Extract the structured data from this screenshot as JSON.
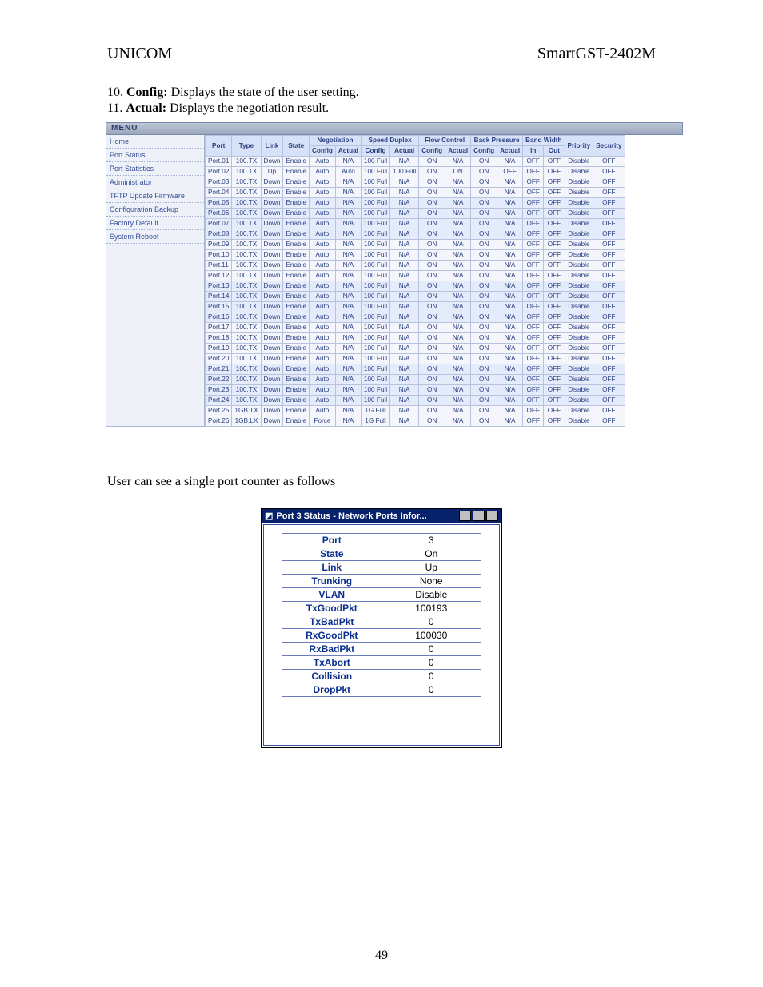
{
  "header": {
    "left": "UNICOM",
    "right": "SmartGST-2402M"
  },
  "definitions": [
    {
      "n": "10.",
      "term": "Config:",
      "desc": "Displays the state of the user setting."
    },
    {
      "n": "11.",
      "term": "Actual:",
      "desc": "Displays the negotiation result."
    }
  ],
  "menu_title": "MENU",
  "menu_items": [
    "Home",
    "Port Status",
    "Port Statistics",
    "Administrator",
    "TFTP Update Firmware",
    "Configuration Backup",
    "Factory Default",
    "System Reboot"
  ],
  "port_headers": {
    "row1": [
      "Port",
      "Type",
      "Link",
      "State",
      "Negotiation",
      "Speed Duplex",
      "Flow Control",
      "Back Pressure",
      "Band Width",
      "Priority",
      "Security"
    ],
    "row2": [
      "Config",
      "Actual",
      "Config",
      "Actual",
      "Config",
      "Actual",
      "Config",
      "Actual",
      "In",
      "Out"
    ]
  },
  "ports": [
    {
      "p": "Port.01",
      "t": "100.TX",
      "l": "Down",
      "s": "Enable",
      "nc": "Auto",
      "na": "N/A",
      "sc": "100 Full",
      "sa": "N/A",
      "fc": "ON",
      "fa": "N/A",
      "bc": "ON",
      "ba": "N/A",
      "wi": "OFF",
      "wo": "OFF",
      "pr": "Disable",
      "se": "OFF"
    },
    {
      "p": "Port.02",
      "t": "100.TX",
      "l": "Up",
      "s": "Enable",
      "nc": "Auto",
      "na": "Auto",
      "sc": "100 Full",
      "sa": "100 Full",
      "fc": "ON",
      "fa": "ON",
      "bc": "ON",
      "ba": "OFF",
      "wi": "OFF",
      "wo": "OFF",
      "pr": "Disable",
      "se": "OFF"
    },
    {
      "p": "Port.03",
      "t": "100.TX",
      "l": "Down",
      "s": "Enable",
      "nc": "Auto",
      "na": "N/A",
      "sc": "100 Full",
      "sa": "N/A",
      "fc": "ON",
      "fa": "N/A",
      "bc": "ON",
      "ba": "N/A",
      "wi": "OFF",
      "wo": "OFF",
      "pr": "Disable",
      "se": "OFF"
    },
    {
      "p": "Port.04",
      "t": "100.TX",
      "l": "Down",
      "s": "Enable",
      "nc": "Auto",
      "na": "N/A",
      "sc": "100 Full",
      "sa": "N/A",
      "fc": "ON",
      "fa": "N/A",
      "bc": "ON",
      "ba": "N/A",
      "wi": "OFF",
      "wo": "OFF",
      "pr": "Disable",
      "se": "OFF"
    },
    {
      "p": "Port.05",
      "t": "100.TX",
      "l": "Down",
      "s": "Enable",
      "nc": "Auto",
      "na": "N/A",
      "sc": "100 Full",
      "sa": "N/A",
      "fc": "ON",
      "fa": "N/A",
      "bc": "ON",
      "ba": "N/A",
      "wi": "OFF",
      "wo": "OFF",
      "pr": "Disable",
      "se": "OFF"
    },
    {
      "p": "Port.06",
      "t": "100.TX",
      "l": "Down",
      "s": "Enable",
      "nc": "Auto",
      "na": "N/A",
      "sc": "100 Full",
      "sa": "N/A",
      "fc": "ON",
      "fa": "N/A",
      "bc": "ON",
      "ba": "N/A",
      "wi": "OFF",
      "wo": "OFF",
      "pr": "Disable",
      "se": "OFF"
    },
    {
      "p": "Port.07",
      "t": "100.TX",
      "l": "Down",
      "s": "Enable",
      "nc": "Auto",
      "na": "N/A",
      "sc": "100 Full",
      "sa": "N/A",
      "fc": "ON",
      "fa": "N/A",
      "bc": "ON",
      "ba": "N/A",
      "wi": "OFF",
      "wo": "OFF",
      "pr": "Disable",
      "se": "OFF"
    },
    {
      "p": "Port.08",
      "t": "100.TX",
      "l": "Down",
      "s": "Enable",
      "nc": "Auto",
      "na": "N/A",
      "sc": "100 Full",
      "sa": "N/A",
      "fc": "ON",
      "fa": "N/A",
      "bc": "ON",
      "ba": "N/A",
      "wi": "OFF",
      "wo": "OFF",
      "pr": "Disable",
      "se": "OFF"
    },
    {
      "p": "Port.09",
      "t": "100.TX",
      "l": "Down",
      "s": "Enable",
      "nc": "Auto",
      "na": "N/A",
      "sc": "100 Full",
      "sa": "N/A",
      "fc": "ON",
      "fa": "N/A",
      "bc": "ON",
      "ba": "N/A",
      "wi": "OFF",
      "wo": "OFF",
      "pr": "Disable",
      "se": "OFF"
    },
    {
      "p": "Port.10",
      "t": "100.TX",
      "l": "Down",
      "s": "Enable",
      "nc": "Auto",
      "na": "N/A",
      "sc": "100 Full",
      "sa": "N/A",
      "fc": "ON",
      "fa": "N/A",
      "bc": "ON",
      "ba": "N/A",
      "wi": "OFF",
      "wo": "OFF",
      "pr": "Disable",
      "se": "OFF"
    },
    {
      "p": "Port.11",
      "t": "100.TX",
      "l": "Down",
      "s": "Enable",
      "nc": "Auto",
      "na": "N/A",
      "sc": "100 Full",
      "sa": "N/A",
      "fc": "ON",
      "fa": "N/A",
      "bc": "ON",
      "ba": "N/A",
      "wi": "OFF",
      "wo": "OFF",
      "pr": "Disable",
      "se": "OFF"
    },
    {
      "p": "Port.12",
      "t": "100.TX",
      "l": "Down",
      "s": "Enable",
      "nc": "Auto",
      "na": "N/A",
      "sc": "100 Full",
      "sa": "N/A",
      "fc": "ON",
      "fa": "N/A",
      "bc": "ON",
      "ba": "N/A",
      "wi": "OFF",
      "wo": "OFF",
      "pr": "Disable",
      "se": "OFF"
    },
    {
      "p": "Port.13",
      "t": "100.TX",
      "l": "Down",
      "s": "Enable",
      "nc": "Auto",
      "na": "N/A",
      "sc": "100 Full",
      "sa": "N/A",
      "fc": "ON",
      "fa": "N/A",
      "bc": "ON",
      "ba": "N/A",
      "wi": "OFF",
      "wo": "OFF",
      "pr": "Disable",
      "se": "OFF"
    },
    {
      "p": "Port.14",
      "t": "100.TX",
      "l": "Down",
      "s": "Enable",
      "nc": "Auto",
      "na": "N/A",
      "sc": "100 Full",
      "sa": "N/A",
      "fc": "ON",
      "fa": "N/A",
      "bc": "ON",
      "ba": "N/A",
      "wi": "OFF",
      "wo": "OFF",
      "pr": "Disable",
      "se": "OFF"
    },
    {
      "p": "Port.15",
      "t": "100.TX",
      "l": "Down",
      "s": "Enable",
      "nc": "Auto",
      "na": "N/A",
      "sc": "100 Full",
      "sa": "N/A",
      "fc": "ON",
      "fa": "N/A",
      "bc": "ON",
      "ba": "N/A",
      "wi": "OFF",
      "wo": "OFF",
      "pr": "Disable",
      "se": "OFF"
    },
    {
      "p": "Port.16",
      "t": "100.TX",
      "l": "Down",
      "s": "Enable",
      "nc": "Auto",
      "na": "N/A",
      "sc": "100 Full",
      "sa": "N/A",
      "fc": "ON",
      "fa": "N/A",
      "bc": "ON",
      "ba": "N/A",
      "wi": "OFF",
      "wo": "OFF",
      "pr": "Disable",
      "se": "OFF"
    },
    {
      "p": "Port.17",
      "t": "100.TX",
      "l": "Down",
      "s": "Enable",
      "nc": "Auto",
      "na": "N/A",
      "sc": "100 Full",
      "sa": "N/A",
      "fc": "ON",
      "fa": "N/A",
      "bc": "ON",
      "ba": "N/A",
      "wi": "OFF",
      "wo": "OFF",
      "pr": "Disable",
      "se": "OFF"
    },
    {
      "p": "Port.18",
      "t": "100.TX",
      "l": "Down",
      "s": "Enable",
      "nc": "Auto",
      "na": "N/A",
      "sc": "100 Full",
      "sa": "N/A",
      "fc": "ON",
      "fa": "N/A",
      "bc": "ON",
      "ba": "N/A",
      "wi": "OFF",
      "wo": "OFF",
      "pr": "Disable",
      "se": "OFF"
    },
    {
      "p": "Port.19",
      "t": "100.TX",
      "l": "Down",
      "s": "Enable",
      "nc": "Auto",
      "na": "N/A",
      "sc": "100 Full",
      "sa": "N/A",
      "fc": "ON",
      "fa": "N/A",
      "bc": "ON",
      "ba": "N/A",
      "wi": "OFF",
      "wo": "OFF",
      "pr": "Disable",
      "se": "OFF"
    },
    {
      "p": "Port.20",
      "t": "100.TX",
      "l": "Down",
      "s": "Enable",
      "nc": "Auto",
      "na": "N/A",
      "sc": "100 Full",
      "sa": "N/A",
      "fc": "ON",
      "fa": "N/A",
      "bc": "ON",
      "ba": "N/A",
      "wi": "OFF",
      "wo": "OFF",
      "pr": "Disable",
      "se": "OFF"
    },
    {
      "p": "Port.21",
      "t": "100.TX",
      "l": "Down",
      "s": "Enable",
      "nc": "Auto",
      "na": "N/A",
      "sc": "100 Full",
      "sa": "N/A",
      "fc": "ON",
      "fa": "N/A",
      "bc": "ON",
      "ba": "N/A",
      "wi": "OFF",
      "wo": "OFF",
      "pr": "Disable",
      "se": "OFF"
    },
    {
      "p": "Port.22",
      "t": "100.TX",
      "l": "Down",
      "s": "Enable",
      "nc": "Auto",
      "na": "N/A",
      "sc": "100 Full",
      "sa": "N/A",
      "fc": "ON",
      "fa": "N/A",
      "bc": "ON",
      "ba": "N/A",
      "wi": "OFF",
      "wo": "OFF",
      "pr": "Disable",
      "se": "OFF"
    },
    {
      "p": "Port.23",
      "t": "100.TX",
      "l": "Down",
      "s": "Enable",
      "nc": "Auto",
      "na": "N/A",
      "sc": "100 Full",
      "sa": "N/A",
      "fc": "ON",
      "fa": "N/A",
      "bc": "ON",
      "ba": "N/A",
      "wi": "OFF",
      "wo": "OFF",
      "pr": "Disable",
      "se": "OFF"
    },
    {
      "p": "Port.24",
      "t": "100.TX",
      "l": "Down",
      "s": "Enable",
      "nc": "Auto",
      "na": "N/A",
      "sc": "100 Full",
      "sa": "N/A",
      "fc": "ON",
      "fa": "N/A",
      "bc": "ON",
      "ba": "N/A",
      "wi": "OFF",
      "wo": "OFF",
      "pr": "Disable",
      "se": "OFF"
    },
    {
      "p": "Port.25",
      "t": "1GB.TX",
      "l": "Down",
      "s": "Enable",
      "nc": "Auto",
      "na": "N/A",
      "sc": "1G Full",
      "sa": "N/A",
      "fc": "ON",
      "fa": "N/A",
      "bc": "ON",
      "ba": "N/A",
      "wi": "OFF",
      "wo": "OFF",
      "pr": "Disable",
      "se": "OFF"
    },
    {
      "p": "Port.26",
      "t": "1GB.LX",
      "l": "Down",
      "s": "Enable",
      "nc": "Force",
      "na": "N/A",
      "sc": "1G Full",
      "sa": "N/A",
      "fc": "ON",
      "fa": "N/A",
      "bc": "ON",
      "ba": "N/A",
      "wi": "OFF",
      "wo": "OFF",
      "pr": "Disable",
      "se": "OFF"
    }
  ],
  "caption2": "User can see a single port counter as follows",
  "window": {
    "title": "Port 3 Status - Network Ports Infor...",
    "rows": [
      [
        "Port",
        "3"
      ],
      [
        "State",
        "On"
      ],
      [
        "Link",
        "Up"
      ],
      [
        "Trunking",
        "None"
      ],
      [
        "VLAN",
        "Disable"
      ],
      [
        "TxGoodPkt",
        "100193"
      ],
      [
        "TxBadPkt",
        "0"
      ],
      [
        "RxGoodPkt",
        "100030"
      ],
      [
        "RxBadPkt",
        "0"
      ],
      [
        "TxAbort",
        "0"
      ],
      [
        "Collision",
        "0"
      ],
      [
        "DropPkt",
        "0"
      ]
    ]
  },
  "page_number": "49"
}
